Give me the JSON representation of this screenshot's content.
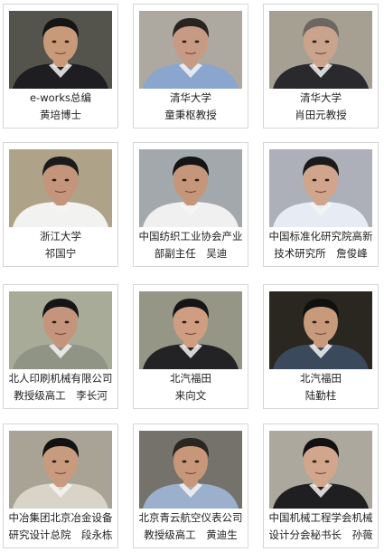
{
  "people": [
    {
      "line1": "e-works总编",
      "line2": "黄培博士",
      "bg": "#5a5a52",
      "shirt": "#1e1e22",
      "skin": "#c99a7a",
      "hair": "#151515"
    },
    {
      "line1": "清华大学",
      "line2": "童秉枢教授",
      "bg": "#b8b3aa",
      "shirt": "#8aa6cf",
      "skin": "#c79b83",
      "hair": "#2a2420"
    },
    {
      "line1": "清华大学",
      "line2": "肖田元教授",
      "bg": "#b0aa9c",
      "shirt": "#2a2a2e",
      "skin": "#c9a38c",
      "hair": "#6c6760"
    },
    {
      "line1": "浙江大学",
      "line2": "祁国宁",
      "bg": "#b9ae92",
      "shirt": "#f2f2f0",
      "skin": "#c4957a",
      "hair": "#1b1b1b"
    },
    {
      "line1": "中国纺织工业协会产业",
      "line2": "部副主任　吴迪",
      "bg": "#aeb3b8",
      "shirt": "#f0f0f0",
      "skin": "#c6967b",
      "hair": "#141414"
    },
    {
      "line1": "中国标准化研究院高新",
      "line2": "技术研究所　詹俊峰",
      "bg": "#b8bcc4",
      "shirt": "#e7ecf4",
      "skin": "#d0a58b",
      "hair": "#1a1a1a"
    },
    {
      "line1": "北人印刷机械有限公司",
      "line2": "教授级高工　李长河",
      "bg": "#b3b6a2",
      "shirt": "#8f9485",
      "skin": "#c4957c",
      "hair": "#151515"
    },
    {
      "line1": "北汽福田",
      "line2": "来向文",
      "bg": "#9fa08e",
      "shirt": "#232326",
      "skin": "#cf9e82",
      "hair": "#151515"
    },
    {
      "line1": "北汽福田",
      "line2": "陆勤柱",
      "bg": "#2c2a22",
      "shirt": "#3a4a5c",
      "skin": "#c89a7c",
      "hair": "#101010"
    },
    {
      "line1": "中冶集团北京冶金设备",
      "line2": "研究设计总院　段永栋",
      "bg": "#b3ae9e",
      "shirt": "#d9d4c8",
      "skin": "#c99b7e",
      "hair": "#121212"
    },
    {
      "line1": "北京青云航空仪表公司",
      "line2": "教授级高工　黄迪生",
      "bg": "#7d7a72",
      "shirt": "#9ab0cc",
      "skin": "#c8977a",
      "hair": "#2a2622"
    },
    {
      "line1": "中国机械工程学会机械",
      "line2": "设计分会秘书长　孙薇",
      "bg": "#b7b3a8",
      "shirt": "#1f1f22",
      "skin": "#d2a68c",
      "hair": "#111111"
    }
  ]
}
